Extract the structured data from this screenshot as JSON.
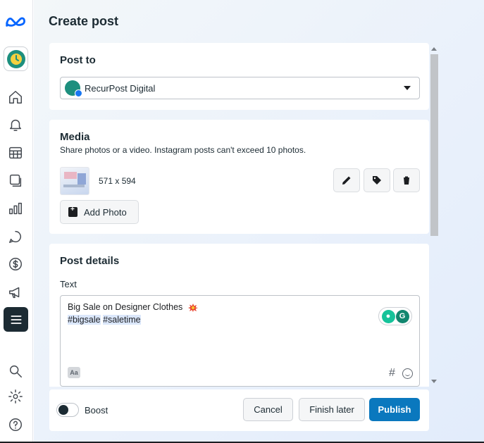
{
  "app": {
    "title": "Create post"
  },
  "rail": {
    "icons": [
      "meta-logo-icon",
      "account-avatar-icon",
      "home-icon",
      "bell-icon",
      "grid-icon",
      "layers-icon",
      "bar-chart-icon",
      "chat-icon",
      "dollar-icon",
      "megaphone-icon",
      "menu-icon",
      "search-icon",
      "gear-icon",
      "help-icon"
    ]
  },
  "post_to": {
    "heading": "Post to",
    "selected_account": "RecurPost Digital"
  },
  "media": {
    "heading": "Media",
    "subtitle": "Share photos or a video. Instagram posts can't exceed 10 photos.",
    "image_dimensions": "571 x 594",
    "add_photo_label": "Add Photo"
  },
  "post_details": {
    "heading": "Post details",
    "text_label": "Text",
    "text_line1": "Big Sale on Designer Clothes",
    "hashtag1": "#bigsale",
    "hashtag2": "#saletime",
    "aa_label": "Aa",
    "hash_symbol": "#"
  },
  "footer": {
    "boost_label": "Boost",
    "cancel_label": "Cancel",
    "finish_later_label": "Finish later",
    "publish_label": "Publish"
  },
  "colors": {
    "primary": "#0a78be",
    "rail_active": "#1c2b33",
    "hashtag_highlight": "#dbe7fb",
    "grammarly": "#15c39a"
  }
}
